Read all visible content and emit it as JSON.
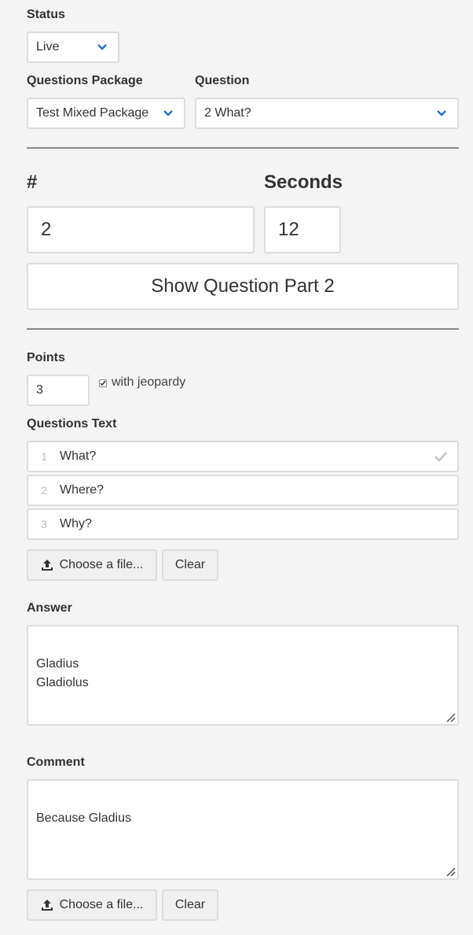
{
  "status": {
    "label": "Status",
    "value": "Live"
  },
  "questions_package": {
    "label": "Questions Package",
    "value": "Test Mixed Package"
  },
  "question": {
    "label": "Question",
    "value": "2 What?"
  },
  "number": {
    "label": "#",
    "value": "2"
  },
  "seconds": {
    "label": "Seconds",
    "value": "12"
  },
  "show_button": {
    "label": "Show Question Part 2"
  },
  "points": {
    "label": "Points",
    "value": "3",
    "jeopardy_label": "with jeopardy",
    "jeopardy_checked": true
  },
  "questions_text": {
    "label": "Questions Text",
    "items": [
      {
        "num": "1",
        "text": "What?",
        "checked": true
      },
      {
        "num": "2",
        "text": "Where?",
        "checked": false
      },
      {
        "num": "3",
        "text": "Why?",
        "checked": false
      }
    ],
    "choose_file": "Choose a file...",
    "clear": "Clear"
  },
  "answer": {
    "label": "Answer",
    "value": "Gladius\nGladiolus"
  },
  "comment": {
    "label": "Comment",
    "value": "Because Gladius",
    "choose_file": "Choose a file...",
    "clear": "Clear"
  },
  "colors": {
    "accent": "#2a6fd6",
    "border": "#dddddd",
    "background": "#f4f4f4"
  }
}
